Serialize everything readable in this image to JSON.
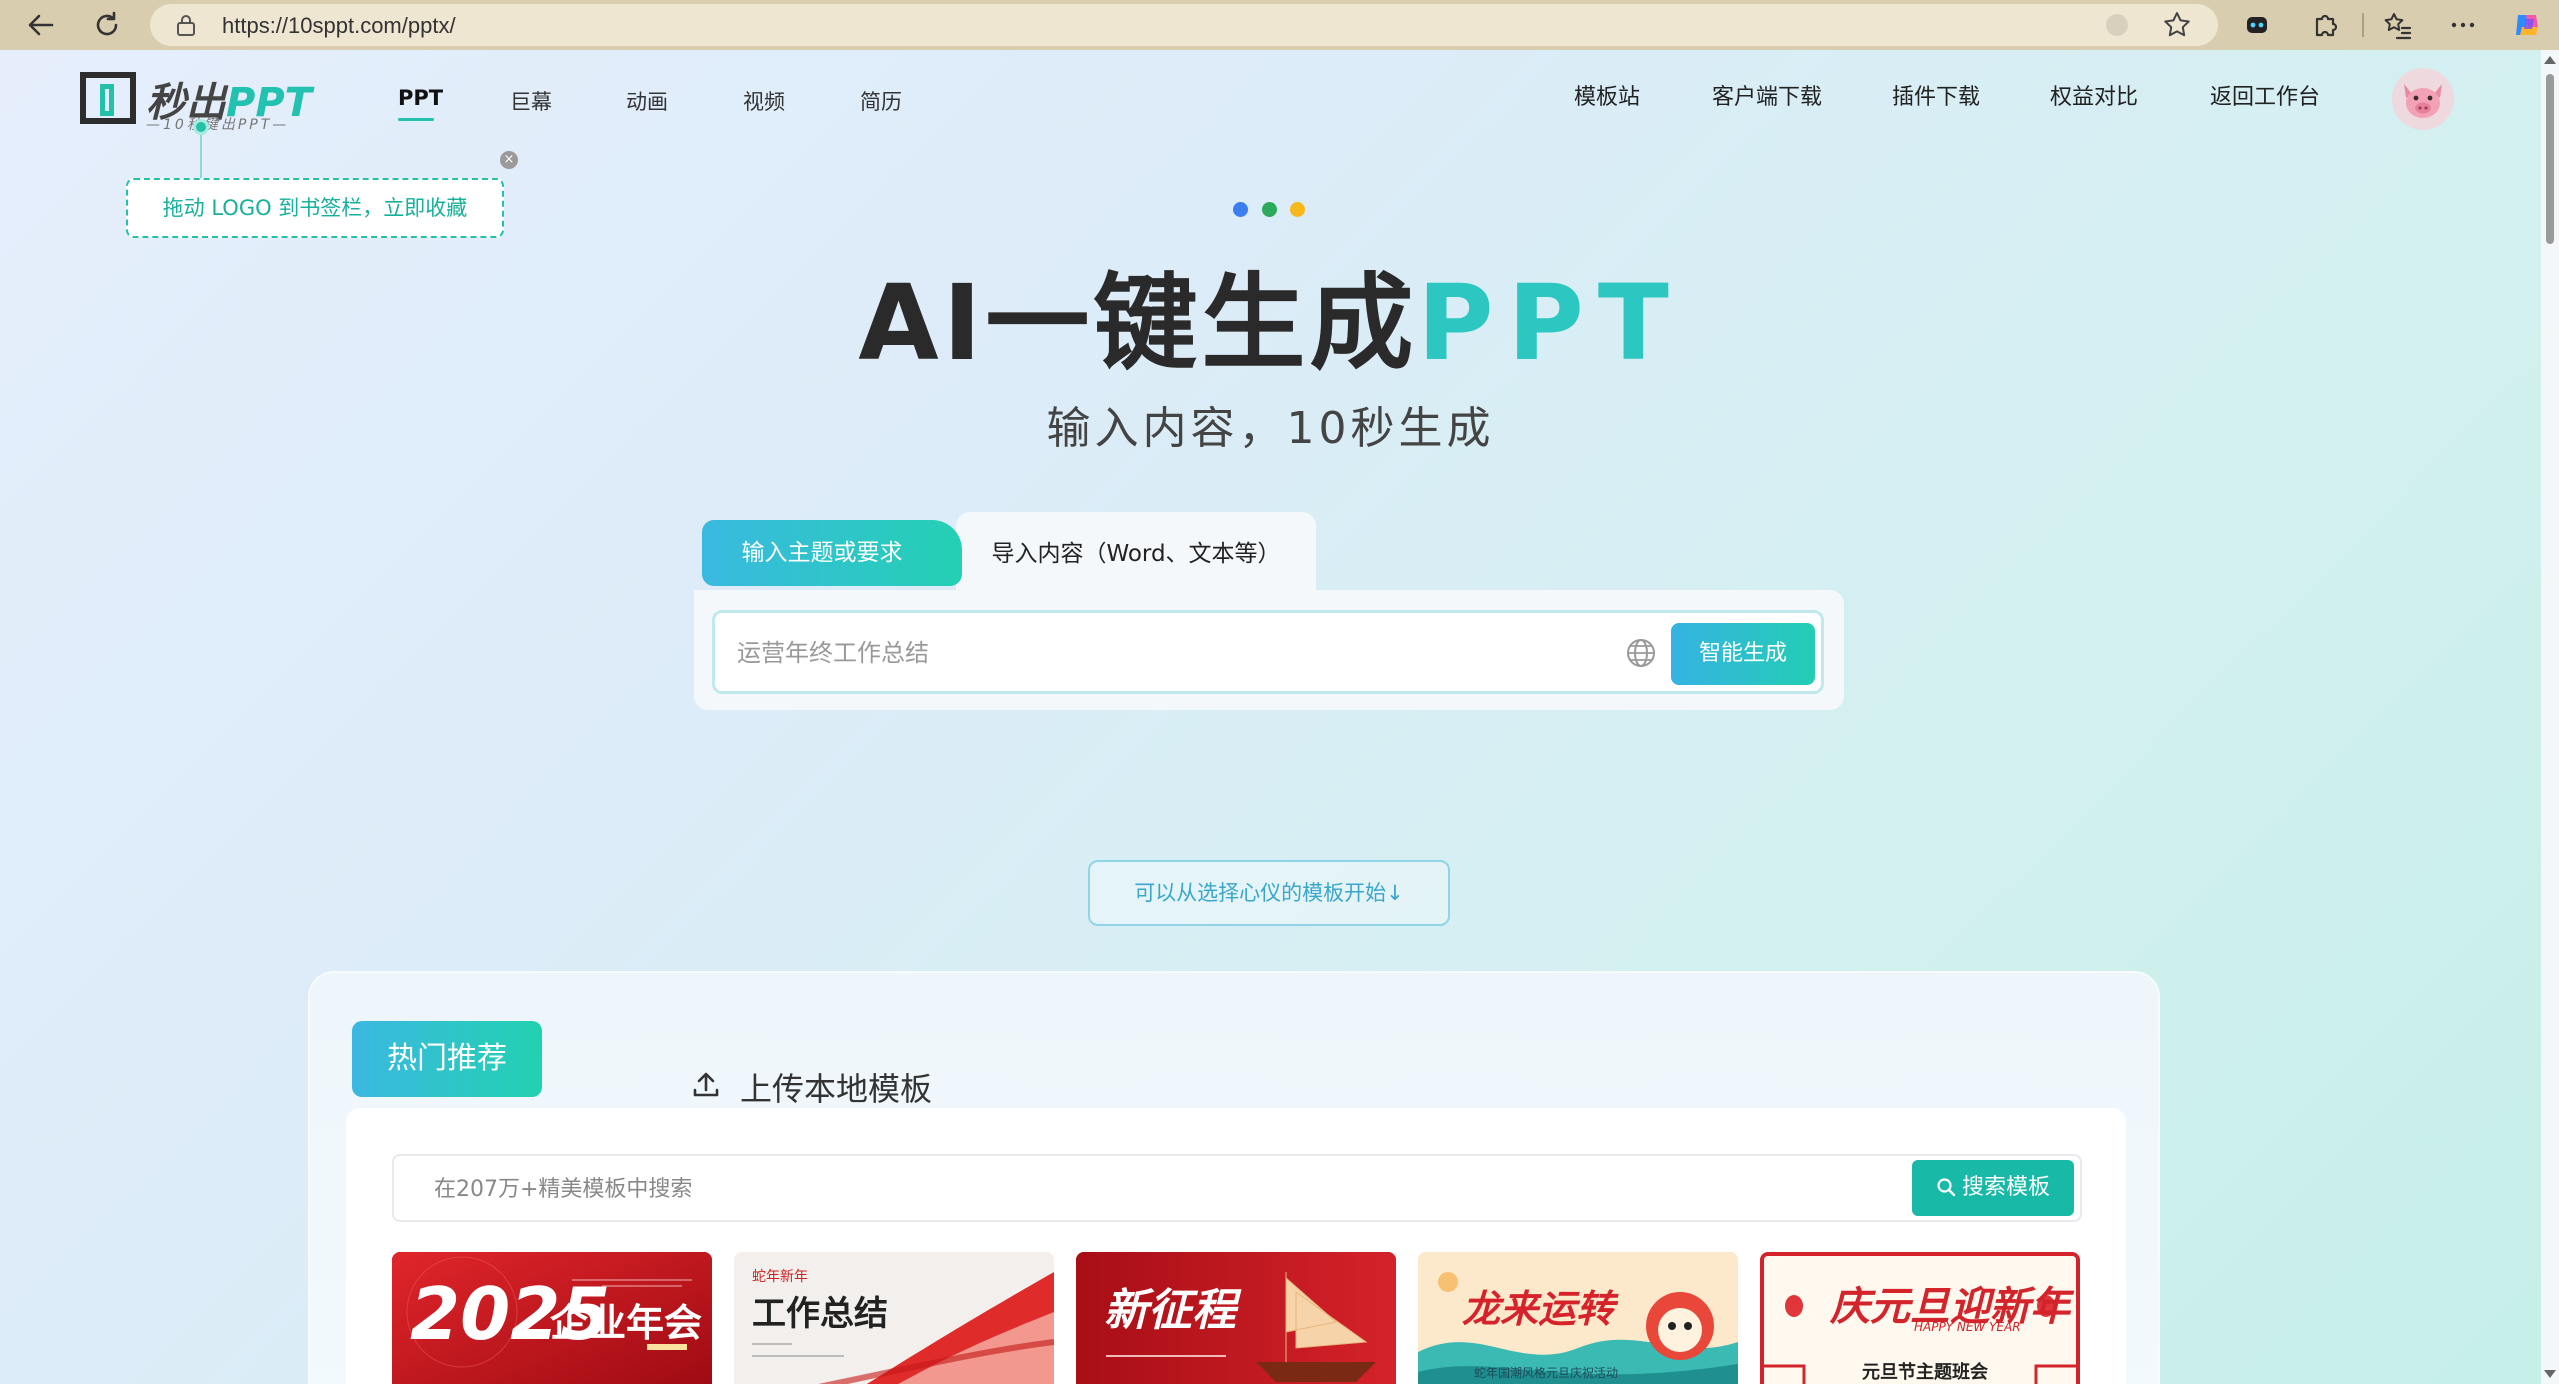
{
  "browser": {
    "url": "https://10sppt.com/pptx/"
  },
  "header": {
    "logo": {
      "brand_prefix": "秒出",
      "brand_accent": "PPT",
      "slogan": "—10秒键出PPT—"
    },
    "main_nav": [
      {
        "label": "PPT",
        "active": true
      },
      {
        "label": "巨幕",
        "active": false
      },
      {
        "label": "动画",
        "active": false
      },
      {
        "label": "视频",
        "active": false
      },
      {
        "label": "简历",
        "active": false
      }
    ],
    "right_nav": [
      {
        "label": "模板站"
      },
      {
        "label": "客户端下载"
      },
      {
        "label": "插件下载"
      },
      {
        "label": "权益对比"
      },
      {
        "label": "返回工作台"
      }
    ]
  },
  "tooltip": {
    "text": "拖动 LOGO 到书签栏，立即收藏"
  },
  "hero": {
    "dot_colors": [
      "#3c7df0",
      "#2aaa5a",
      "#f6b81a"
    ],
    "title_main": "AI一键生成",
    "title_accent": "PPT",
    "subtitle": "输入内容，10秒生成"
  },
  "generator": {
    "tabs": [
      {
        "label": "输入主题或要求",
        "active": true
      },
      {
        "label": "导入内容（Word、文本等）",
        "active": false
      }
    ],
    "input_placeholder": "运营年终工作总结",
    "submit_label": "智能生成"
  },
  "choose_template_label": "可以从选择心仪的模板开始↓",
  "templates": {
    "tabs": [
      {
        "label": "热门推荐",
        "active": true
      },
      {
        "label": "上传本地模板",
        "active": false
      }
    ],
    "search_placeholder": "在207万+精美模板中搜索",
    "search_button": "搜索模板",
    "cards": [
      {
        "title": "企业年会",
        "year": "2025"
      },
      {
        "title": "工作总结",
        "tag": "蛇年新年"
      },
      {
        "title": "新征程"
      },
      {
        "title": "龙来运转",
        "sub": "蛇年国潮风格元旦庆祝活动"
      },
      {
        "title": "庆元旦迎新年",
        "tag": "HAPPY NEW YEAR",
        "sub": "元旦节主题班会"
      }
    ]
  },
  "colors": {
    "accent": "#22c1b0",
    "gradient_start": "#3ab9e0",
    "gradient_end": "#24d0b3"
  }
}
